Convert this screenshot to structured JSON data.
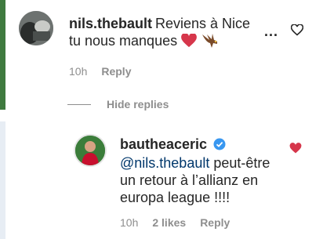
{
  "comment": {
    "username": "nils.thebault",
    "text": "Reviens à Nice tu nous manques",
    "time": "10h",
    "reply_label": "Reply",
    "more_label": "..."
  },
  "hide_replies_label": "Hide replies",
  "reply": {
    "username": "bautheaceric",
    "mention": "@nils.thebault",
    "text": "peut-être un retour à l’allianz en europa league !!!!",
    "time": "10h",
    "likes": "2 likes",
    "reply_label": "Reply"
  },
  "colors": {
    "heart": "#d6364b",
    "verified": "#3897f0",
    "meta": "#8e8e8e",
    "mention": "#00376b"
  },
  "icons": [
    "heart-outline-icon",
    "heart-filled-icon",
    "verified-badge-icon",
    "more-icon",
    "red-heart-emoji",
    "eagle-emoji"
  ]
}
